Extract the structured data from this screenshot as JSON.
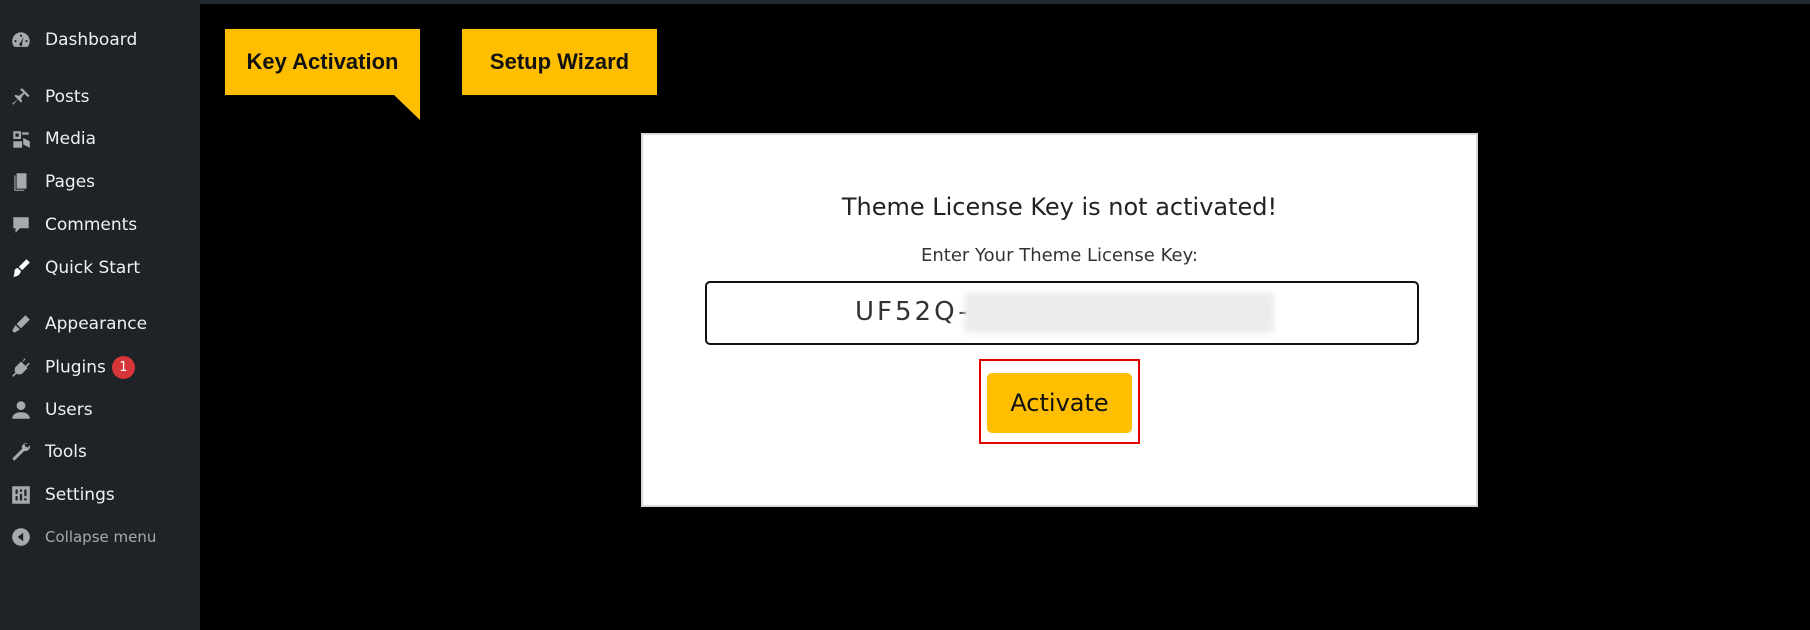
{
  "sidebar": {
    "items": [
      {
        "label": "Dashboard",
        "icon": "dashboard-icon"
      },
      {
        "label": "Posts",
        "icon": "pin-icon"
      },
      {
        "label": "Media",
        "icon": "media-icon"
      },
      {
        "label": "Pages",
        "icon": "pages-icon"
      },
      {
        "label": "Comments",
        "icon": "comment-icon"
      },
      {
        "label": "Quick Start",
        "icon": "paintbrush-icon"
      },
      {
        "label": "Appearance",
        "icon": "appearance-icon"
      },
      {
        "label": "Plugins",
        "icon": "plugin-icon",
        "badge": "1"
      },
      {
        "label": "Users",
        "icon": "user-icon"
      },
      {
        "label": "Tools",
        "icon": "wrench-icon"
      },
      {
        "label": "Settings",
        "icon": "settings-icon"
      },
      {
        "label": "Collapse menu",
        "icon": "collapse-icon"
      }
    ]
  },
  "tabs": {
    "key_activation": "Key Activation",
    "setup_wizard": "Setup Wizard"
  },
  "card": {
    "title": "Theme License Key is not activated!",
    "subtitle": "Enter Your Theme License Key:",
    "license_key_visible": "UF52Q-",
    "activate_label": "Activate"
  },
  "colors": {
    "accent": "#ffbf00",
    "sidebar_bg": "#1d2327",
    "page_bg": "#000000",
    "badge": "#d63638",
    "highlight": "#e00000"
  }
}
